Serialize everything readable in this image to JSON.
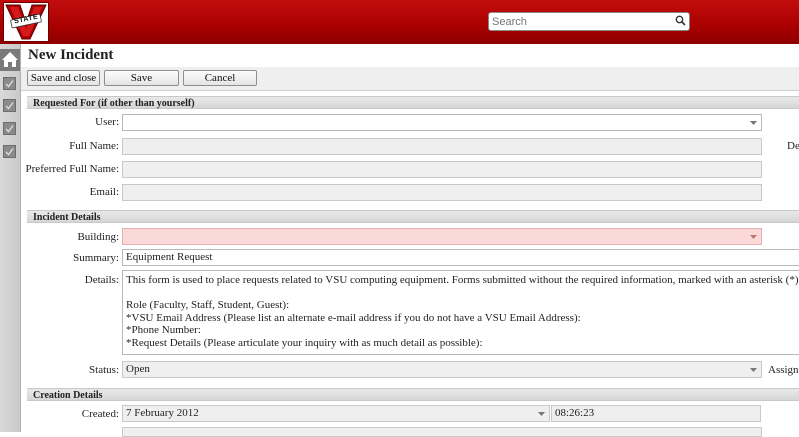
{
  "header": {
    "logo_text": "STATE",
    "search_placeholder": "Search"
  },
  "page": {
    "title": "New Incident"
  },
  "toolbar": {
    "save_close_label": "Save and close",
    "save_label": "Save",
    "cancel_label": "Cancel"
  },
  "requested_for": {
    "header": "Requested For (if other than yourself)",
    "user_label": "User:",
    "user_value": "",
    "full_name_label": "Full Name:",
    "preferred_name_label": "Preferred Full Name:",
    "email_label": "Email:",
    "side_label_partial": "De"
  },
  "incident_details": {
    "header": "Incident Details",
    "building_label": "Building:",
    "building_value": "",
    "summary_label": "Summary:",
    "summary_value": "Equipment Request",
    "details_label": "Details:",
    "details_value": "This form is used to place requests related to VSU computing equipment. Forms submitted without the required information, marked with an asterisk (*), will :\n\nRole (Faculty, Staff, Student, Guest):\n*VSU Email Address (Please list an alternate e-mail address if you do not have a VSU Email Address):\n*Phone Number:\n*Request Details (Please articulate your inquiry with as much detail as possible):",
    "status_label": "Status:",
    "status_value": "Open",
    "assignee_label_partial": "Assigne"
  },
  "creation_details": {
    "header": "Creation Details",
    "created_label": "Created:",
    "created_date": "7 February 2012",
    "created_time": "08:26:23"
  },
  "colors": {
    "header_red": "#a80000",
    "required_pink": "#fbd9d9"
  }
}
